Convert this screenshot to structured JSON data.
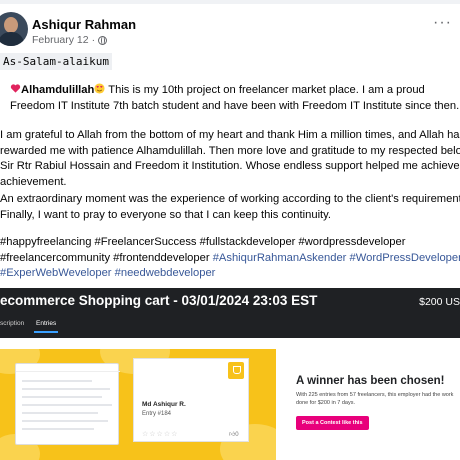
{
  "post": {
    "author": "Ashiqur Rahman",
    "date": "February 12",
    "date_separator": "·",
    "greeting": "As-Salam-alaikum",
    "p1_a": "Alhamdulillah",
    "p1_b": " This is my 10th project on freelancer market place. I am a proud",
    "p1_c": "Freedom IT Institute 7th batch student and have been with Freedom IT Institute since then.",
    "p2_a": "I am grateful to Allah from the bottom of my heart and thank Him a million times, and Allah has",
    "p2_b": "rewarded me with patience Alhamdulillah. Then more love and gratitude to my respected beloved",
    "p2_c": "Sir Rtr Rabiul Hossain and Freedom it Institution. Whose endless support helped me achieve this",
    "p2_d": "achievement.",
    "p3_a": "An extraordinary moment was the experience of working according to the client's requirements,",
    "p3_b": "Finally, I want to pray to everyone so that I can keep this continuity.",
    "tags_l1": "#happyfreelancing #FreelancerSuccess #fullstackdeveloper #wordpressdeveloper",
    "tags_l2_plain": "#freelancercommunity #frontenddeveloper ",
    "tags_l2_link1": "#AshiqurRahmanAskender",
    "tags_l2_link2": "#WordPressDeveloper",
    "tags_l3_link1": "#ExperWebWeveloper",
    "tags_l3_link2": "#needwebdeveloper"
  },
  "project": {
    "title": "ecommerce Shopping cart - 03/01/2024 23:03 EST",
    "price": "$200 US",
    "tab_description": "scription",
    "tab_entries": "Entries"
  },
  "winner": {
    "entry_name": "Md Ashiqur R.",
    "entry_number": "Entry #184",
    "likes": "0",
    "headline": "A winner has been chosen!",
    "description": "With 225 entries from 57 freelancers, this employer had the work done for $200 in 7 days.",
    "cta": "Post a Contest like this"
  },
  "icons": {
    "more": "more-options-icon",
    "globe": "globe-icon",
    "heart": "heart-icon",
    "trophy": "trophy-icon"
  },
  "colors": {
    "link": "#385898",
    "banner": "#f7c21a",
    "cta": "#e8007b",
    "dark_header": "#1f2124"
  }
}
